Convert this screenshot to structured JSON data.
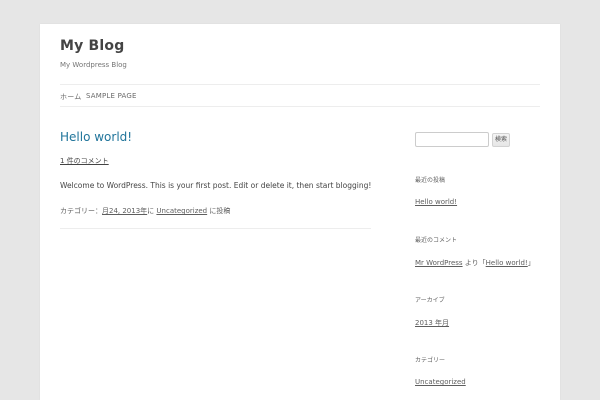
{
  "site": {
    "title": "My Blog",
    "description": "My Wordpress Blog"
  },
  "nav": {
    "home": "ホーム",
    "sample_page": "SAMPLE PAGE"
  },
  "post": {
    "title": "Hello world!",
    "comments": "1 件のコメント",
    "body": "Welcome to WordPress. This is your first post. Edit or delete it, then start blogging!",
    "meta_prefix": "カテゴリー：",
    "meta_date": "月24, 2013年",
    "meta_sep": "に",
    "meta_category": "Uncategorized",
    "meta_suffix": "に投稿"
  },
  "sidebar": {
    "search_placeholder": "",
    "search_button": "検索",
    "recent_posts_title": "最近の投稿",
    "recent_post_link": "Hello world!",
    "recent_comments_title": "最近のコメント",
    "recent_comment_author": "Mr WordPress",
    "recent_comment_on": "より「",
    "recent_comment_post": "Hello world!",
    "recent_comment_end": "」",
    "archives_title": "アーカイブ",
    "archive_link": "2013 年月",
    "categories_title": "カテゴリー",
    "category_link": "Uncategorized"
  }
}
